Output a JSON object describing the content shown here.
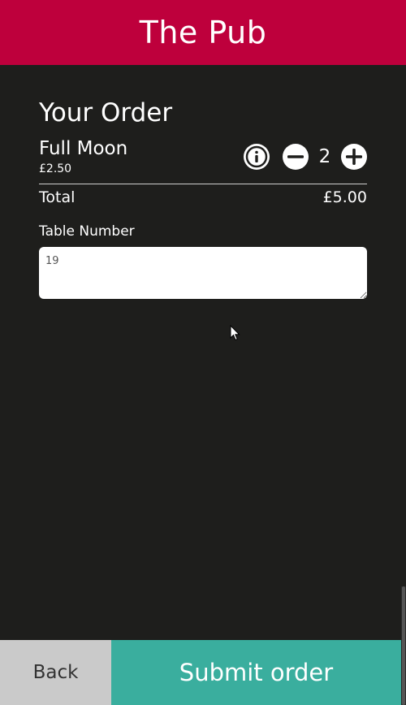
{
  "header": {
    "title": "The Pub"
  },
  "order": {
    "heading": "Your Order",
    "items": [
      {
        "name": "Full Moon",
        "price": "£2.50",
        "quantity": "2"
      }
    ],
    "total_label": "Total",
    "total_value": "£5.00"
  },
  "table": {
    "label": "Table Number",
    "value": "19"
  },
  "footer": {
    "back_label": "Back",
    "submit_label": "Submit order"
  },
  "icons": {
    "info": "info-icon",
    "minus": "minus-circle-icon",
    "plus": "plus-circle-icon",
    "cursor": "mouse-pointer-icon"
  },
  "colors": {
    "header_bg": "#be003c",
    "page_bg": "#1e1e1c",
    "submit_bg": "#3aae9e",
    "back_bg": "#cacaca"
  }
}
